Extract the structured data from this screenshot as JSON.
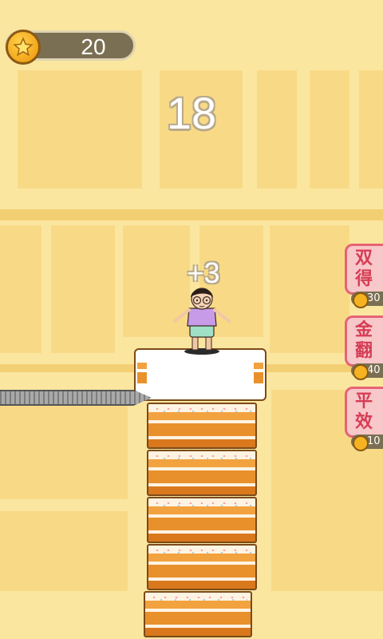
{
  "hud": {
    "coins": "20",
    "score": "18",
    "bonus_popup": "+3"
  },
  "powerups": [
    {
      "label_line1": "双",
      "label_line2": "得",
      "cost": "30"
    },
    {
      "label_line1": "金",
      "label_line2": "翻",
      "cost": "40"
    },
    {
      "label_line1": "平",
      "label_line2": "效",
      "cost": "10"
    }
  ],
  "colors": {
    "background": "#fbe6a0",
    "cake_orange": "#e8912c",
    "powerup_border": "#e46475",
    "coin_gold": "#f5b321"
  },
  "icons": {
    "coin": "star-coin-icon",
    "cost_coin": "star-coin-icon"
  }
}
